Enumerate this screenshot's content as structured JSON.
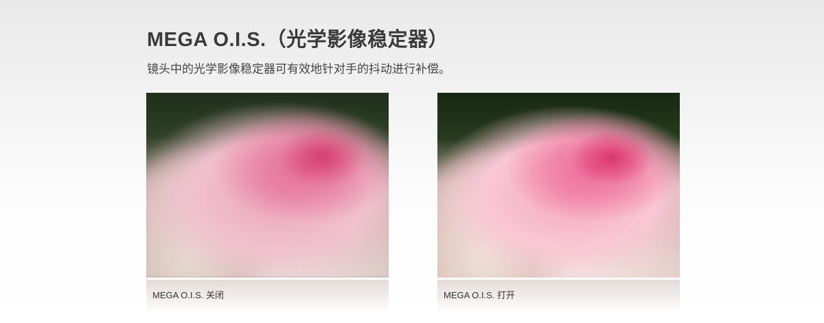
{
  "header": {
    "title": "MEGA O.I.S.（光学影像稳定器）",
    "subtitle": "镜头中的光学影像稳定器可有效地针对手的抖动进行补偿。"
  },
  "comparison": [
    {
      "caption": "MEGA O.I.S. 关闭"
    },
    {
      "caption": "MEGA O.I.S. 打开"
    }
  ]
}
